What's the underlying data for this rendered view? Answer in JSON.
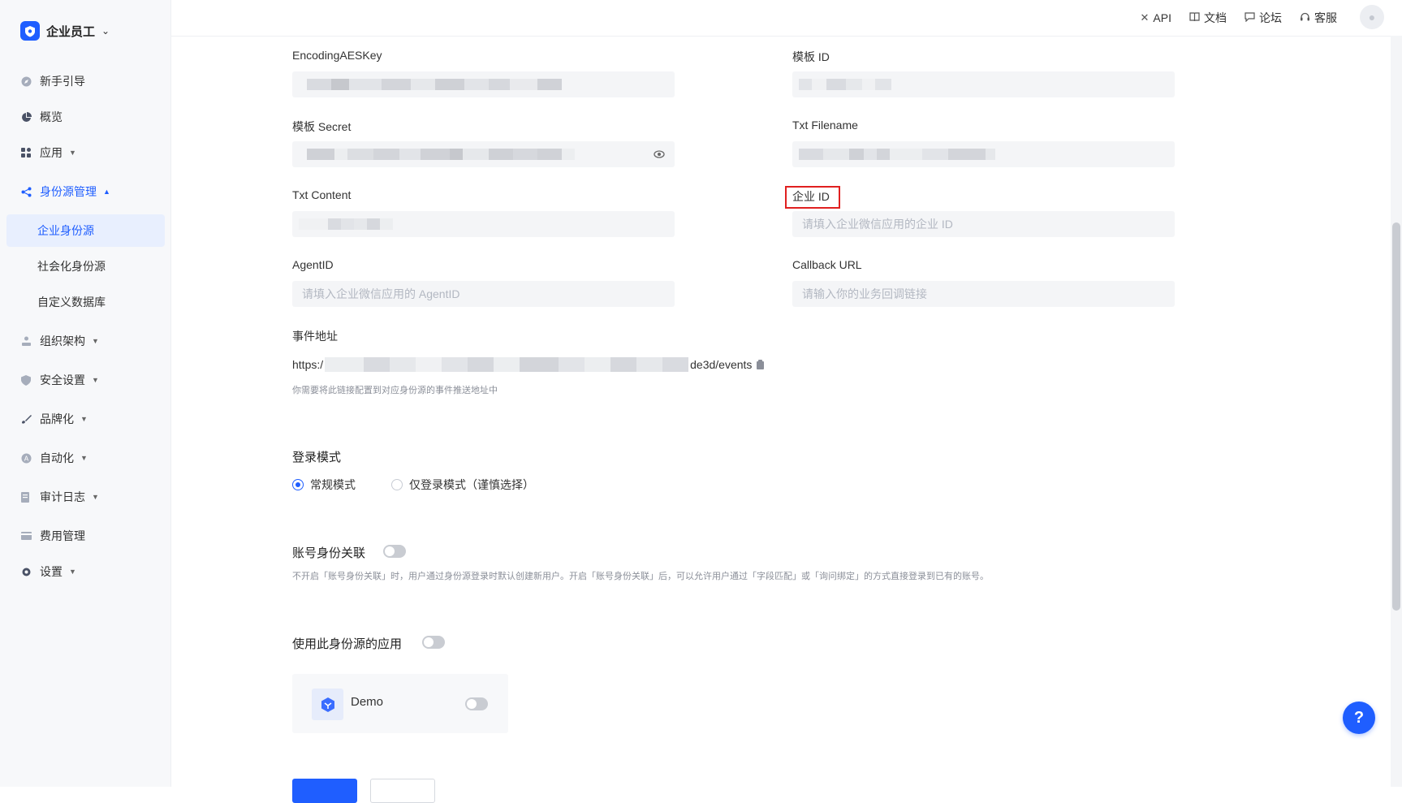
{
  "brand": {
    "name": "企业员工"
  },
  "sidebar": {
    "items": [
      {
        "label": "新手引导",
        "icon": "compass-icon"
      },
      {
        "label": "概览",
        "icon": "pie-chart-icon"
      },
      {
        "label": "应用",
        "icon": "apps-grid-icon"
      },
      {
        "label": "身份源管理",
        "icon": "share-icon",
        "open": true
      },
      {
        "label": "组织架构",
        "icon": "org-icon"
      },
      {
        "label": "安全设置",
        "icon": "shield-icon"
      },
      {
        "label": "品牌化",
        "icon": "brush-icon"
      },
      {
        "label": "自动化",
        "icon": "robot-icon"
      },
      {
        "label": "审计日志",
        "icon": "log-icon"
      },
      {
        "label": "费用管理",
        "icon": "billing-icon"
      },
      {
        "label": "设置",
        "icon": "gear-icon"
      }
    ],
    "sub_items": [
      {
        "label": "企业身份源",
        "active": true
      },
      {
        "label": "社会化身份源"
      },
      {
        "label": "自定义数据库"
      }
    ]
  },
  "topbar": {
    "links": [
      {
        "label": "API",
        "icon": "api-icon"
      },
      {
        "label": "文档",
        "icon": "book-icon"
      },
      {
        "label": "论坛",
        "icon": "chat-icon"
      },
      {
        "label": "客服",
        "icon": "headset-icon"
      }
    ]
  },
  "form": {
    "encoding_aes_key": {
      "label": "EncodingAESKey"
    },
    "template_id": {
      "label": "模板 ID"
    },
    "template_secret": {
      "label": "模板 Secret"
    },
    "txt_filename": {
      "label": "Txt Filename"
    },
    "txt_content": {
      "label": "Txt Content"
    },
    "corp_id": {
      "label": "企业 ID",
      "placeholder": "请填入企业微信应用的企业 ID"
    },
    "agent_id": {
      "label": "AgentID",
      "placeholder": "请填入企业微信应用的 AgentID"
    },
    "callback_url": {
      "label": "Callback URL",
      "placeholder": "请输入你的业务回调链接"
    },
    "event_url": {
      "label": "事件地址",
      "prefix": "https:/",
      "suffix": "de3d/events",
      "hint": "你需要将此链接配置到对应身份源的事件推送地址中"
    }
  },
  "login_mode": {
    "title": "登录模式",
    "options": [
      {
        "label": "常规模式",
        "selected": true
      },
      {
        "label": "仅登录模式（谨慎选择）",
        "selected": false
      }
    ]
  },
  "account_link": {
    "title": "账号身份关联",
    "enabled": false,
    "hint": "不开启「账号身份关联」时，用户通过身份源登录时默认创建新用户。开启「账号身份关联」后，可以允许用户通过「字段匹配」或「询问绑定」的方式直接登录到已有的账号。"
  },
  "apps_using": {
    "title": "使用此身份源的应用",
    "enabled": false,
    "apps": [
      {
        "name": "Demo",
        "enabled": false
      }
    ]
  },
  "help": {
    "label": "?"
  },
  "colors": {
    "primary": "#1f5eff",
    "highlight": "#e02020"
  }
}
